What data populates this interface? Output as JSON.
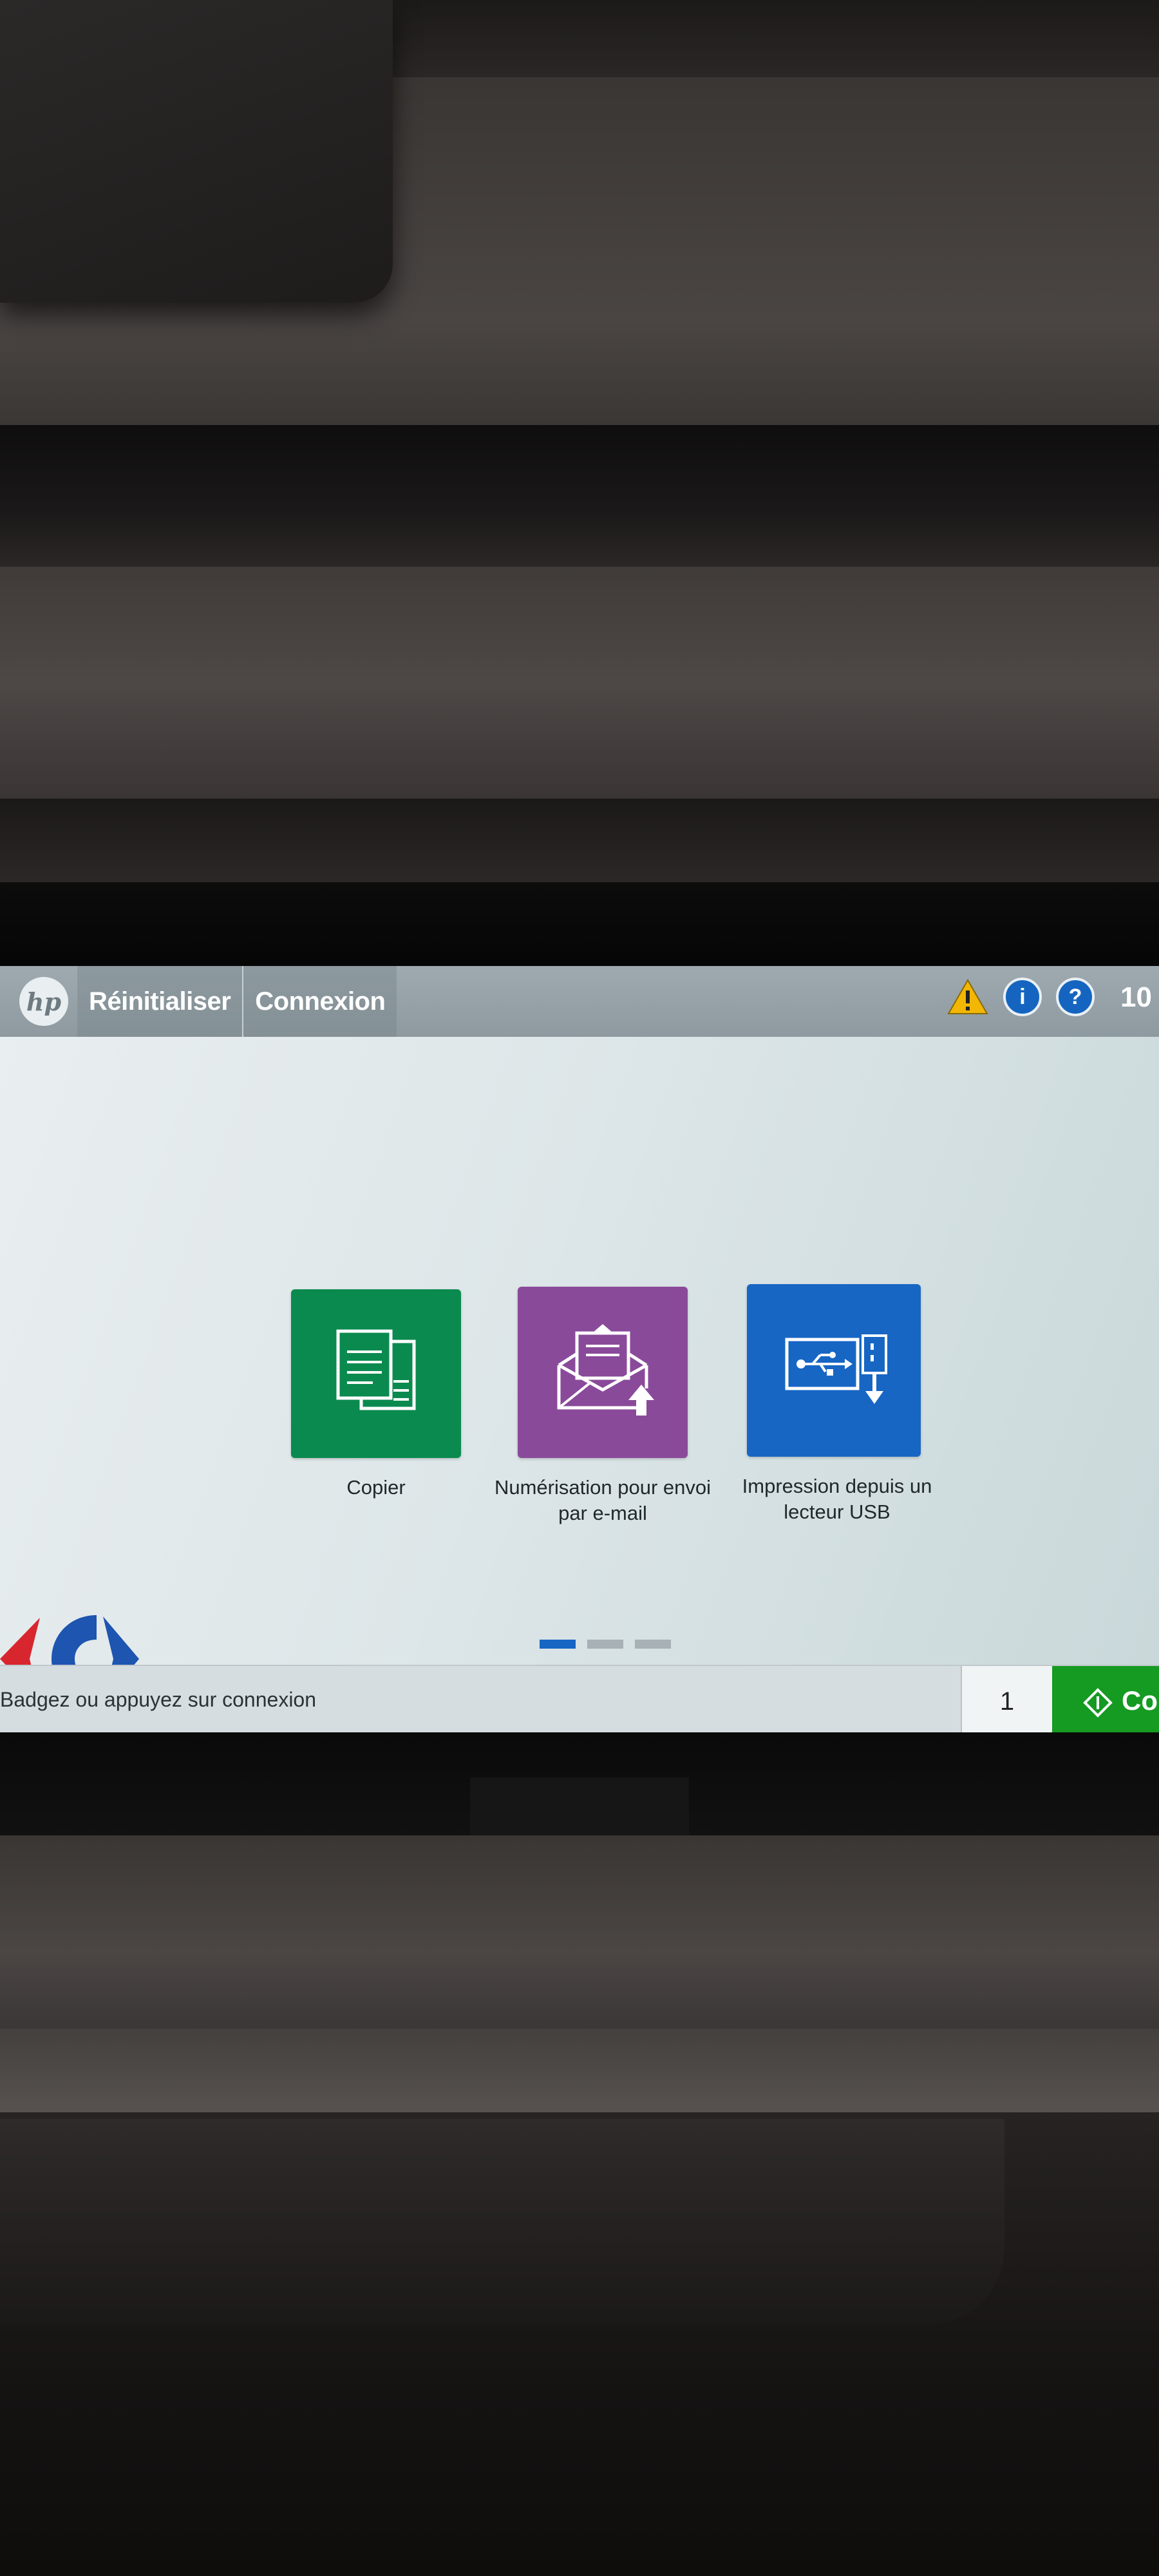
{
  "topbar": {
    "logo": "hp",
    "reset_label": "Réinitialiser",
    "login_label": "Connexion",
    "status_icons": [
      "warning-icon",
      "info-icon",
      "help-icon"
    ],
    "clock_partial": "10"
  },
  "tiles": [
    {
      "label": "Copier",
      "icon": "copy-icon",
      "color": "#0b8a4f"
    },
    {
      "label_line1": "Numérisation pour envoi",
      "label_line2": "par e-mail",
      "icon": "scan-email-icon",
      "color": "#8a4a9a"
    },
    {
      "label_line1": "Impression depuis un",
      "label_line2": "lecteur USB",
      "icon": "usb-print-icon",
      "color": "#1766c4"
    }
  ],
  "pager": {
    "pages": 3,
    "active": 1
  },
  "bottombar": {
    "status_message": "Badgez ou appuyez sur connexion",
    "copies": "1",
    "start_label": "Co",
    "start_color": "#159a22"
  },
  "accent": "#1766c4"
}
